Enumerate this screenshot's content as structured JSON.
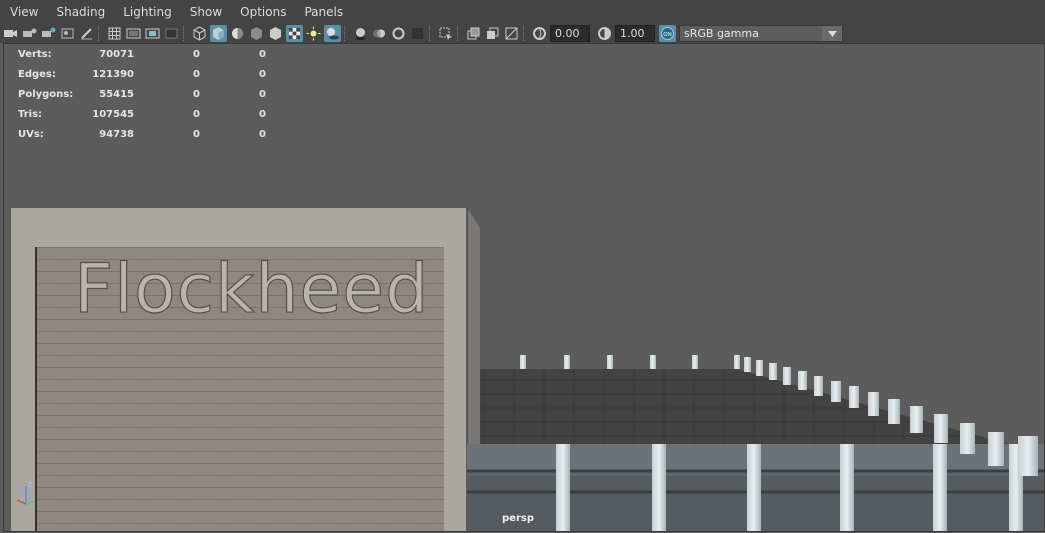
{
  "menubar": {
    "items": [
      "View",
      "Shading",
      "Lighting",
      "Show",
      "Options",
      "Panels"
    ]
  },
  "toolbar": {
    "exposure_value": "0.00",
    "gamma_value": "1.00",
    "color_space": "sRGB gamma",
    "icons": [
      "camera-icon",
      "camera-attributes-icon",
      "bookmark-icon",
      "image-plane-icon",
      "grease-pencil-icon",
      "grid-icon",
      "film-gate-icon",
      "resolution-gate-icon",
      "gate-mask-icon",
      "field-chart-icon",
      "wireframe-icon",
      "smooth-shade-icon",
      "default-material-icon",
      "xray-icon",
      "lights-icon",
      "textured-icon",
      "isolate-select-icon",
      "shadows-icon",
      "ambient-occlusion-icon",
      "motion-blur-icon",
      "anti-aliasing-icon",
      "depth-of-field-icon",
      "select-camera-icon",
      "two-sided-lighting-icon",
      "backface-culling-icon",
      "smooth-wireframe-icon",
      "exposure-icon",
      "gamma-icon",
      "color-management-icon"
    ]
  },
  "hud": {
    "rows": [
      {
        "label": "Verts:",
        "v1": "70071",
        "v2": "0",
        "v3": "0"
      },
      {
        "label": "Edges:",
        "v1": "121390",
        "v2": "0",
        "v3": "0"
      },
      {
        "label": "Polygons:",
        "v1": "55415",
        "v2": "0",
        "v3": "0"
      },
      {
        "label": "Tris:",
        "v1": "107545",
        "v2": "0",
        "v3": "0"
      },
      {
        "label": "UVs:",
        "v1": "94738",
        "v2": "0",
        "v3": "0"
      }
    ]
  },
  "viewport": {
    "camera": "persp",
    "sign_text": "Flockheed",
    "axis_label": "z"
  },
  "colors": {
    "accent": "#5a8fa8",
    "background": "#5c5c5c",
    "menubar": "#444444"
  }
}
